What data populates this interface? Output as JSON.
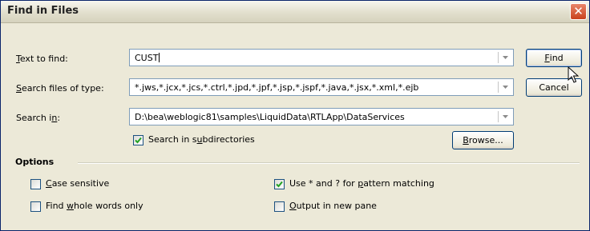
{
  "window": {
    "title": "Find in Files"
  },
  "fields": {
    "text_to_find": {
      "label": "Text to find:",
      "accel": "T",
      "rest": "ext to find:",
      "value": "CUST"
    },
    "search_files_of_type": {
      "label": "Search files of type:",
      "accel": "S",
      "rest": "earch files of type:",
      "value": "*.jws,*.jcx,*.jcs,*.ctrl,*.jpd,*.jpf,*.jsp,*.jspf,*.java,*.jsx,*.xml,*.ejb"
    },
    "search_in": {
      "label": "Search in:",
      "pre": "Search i",
      "accel": "n",
      "post": ":",
      "value": "D:\\bea\\weblogic81\\samples\\LiquidData\\RTLApp\\DataServices"
    }
  },
  "buttons": {
    "find": {
      "label": "Find",
      "accel": "F",
      "rest": "ind"
    },
    "cancel": {
      "label": "Cancel"
    },
    "browse": {
      "label": "Browse...",
      "accel": "B",
      "rest": "rowse..."
    }
  },
  "subdirs": {
    "label": "Search in subdirectories",
    "pre": "Search in s",
    "accel": "u",
    "post": "bdirectories",
    "checked": true
  },
  "options": {
    "heading": "Options",
    "case_sensitive": {
      "label": "Case sensitive",
      "accel": "C",
      "rest": "ase sensitive",
      "checked": false
    },
    "whole_words": {
      "label": "Find whole words only",
      "pre": "Find ",
      "accel": "w",
      "post": "hole words only",
      "checked": false
    },
    "pattern": {
      "label": "Use * and ? for pattern matching",
      "pre": "Use * and ? for ",
      "accel": "p",
      "post": "attern matching",
      "checked": true
    },
    "new_pane": {
      "label": "Output in new pane",
      "accel": "O",
      "rest": "utput in new pane",
      "checked": false
    }
  },
  "icons": {
    "close": "close-icon",
    "dropdown": "chevron-down-icon",
    "check": "checkmark-icon",
    "cursor": "mouse-pointer-icon"
  }
}
